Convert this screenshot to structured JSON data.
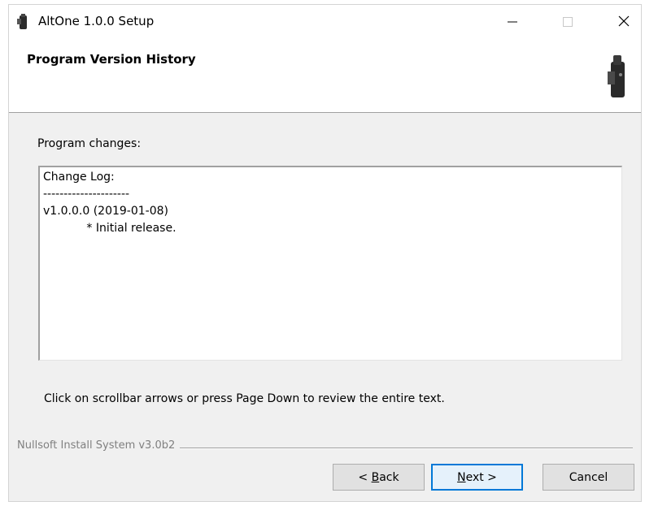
{
  "window": {
    "title": "AltOne 1.0.0 Setup"
  },
  "header": {
    "title": "Program Version History"
  },
  "content": {
    "label": "Program changes:",
    "changelog": [
      "Change Log:",
      "---------------------",
      "v1.0.0.0 (2019-01-08)",
      "            * Initial release."
    ],
    "hint": "Click on scrollbar arrows or press Page Down to review the entire text."
  },
  "footer": {
    "brand": "Nullsoft Install System v3.0b2"
  },
  "buttons": {
    "back_prefix": "< ",
    "back_accel": "B",
    "back_rest": "ack",
    "next_accel": "N",
    "next_rest": "ext >",
    "cancel": "Cancel"
  },
  "icons": {
    "app": "installer-icon",
    "minimize": "minimize-icon",
    "maximize": "maximize-icon",
    "close": "close-icon"
  },
  "colors": {
    "accent": "#0078d7",
    "dialog_bg": "#f0f0f0"
  }
}
